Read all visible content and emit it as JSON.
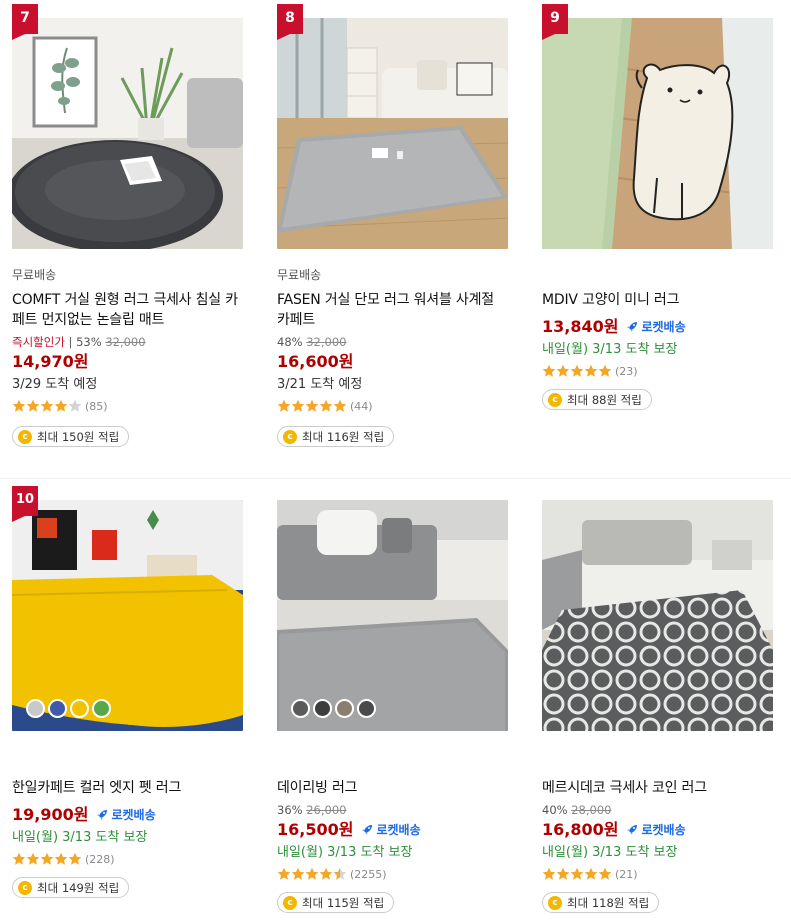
{
  "colors": {
    "rank_red": "#c8102e",
    "price_red": "#ae0000",
    "rocket_blue": "#1d6ae5",
    "delivery_green": "#2f8f3a",
    "star_orange": "#f5a623",
    "coin_yellow": "#f3b700"
  },
  "products": [
    {
      "rank": "7",
      "image": "round-gray-shaggy-rug",
      "shipping": "무료배송",
      "title": "COMFT 거실 원형 러그 극세사 침실 카페트 먼지없는 논슬립 매트",
      "discount": {
        "instant": "즉시할인가",
        "percent": "53%",
        "original": "32,000"
      },
      "price": "14,970원",
      "rocket": "",
      "delivery": "3/29 도착 예정",
      "rating": 4,
      "review_count": "(85)",
      "points": "최대 150원 적립"
    },
    {
      "rank": "8",
      "image": "gray-shortpile-rug-living-room",
      "shipping": "무료배송",
      "title": "FASEN 거실 단모 러그 워셔블 사계절 카페트",
      "discount": {
        "instant": "",
        "percent": "48%",
        "original": "32,000"
      },
      "price": "16,600원",
      "rocket": "",
      "delivery": "3/21 도착 예정",
      "rating": 5,
      "review_count": "(44)",
      "points": "최대 116원 적립"
    },
    {
      "rank": "9",
      "image": "cat-shaped-mini-rug",
      "shipping": "",
      "title": "MDIV 고양이 미니 러그",
      "discount": {
        "instant": "",
        "percent": "",
        "original": ""
      },
      "price": "13,840원",
      "rocket": "로켓배송",
      "delivery": "내일(월) 3/13 도착 보장",
      "rating": 5,
      "review_count": "(23)",
      "points": "최대 88원 적립"
    },
    {
      "rank": "10",
      "image": "yellow-color-edge-pet-rug",
      "shipping": "",
      "title": "한일카페트 컬러 엣지 펫 러그",
      "discount": {
        "instant": "",
        "percent": "",
        "original": ""
      },
      "price": "19,900원",
      "rocket": "로켓배송",
      "delivery": "내일(월) 3/13 도착 보장",
      "rating": 5,
      "review_count": "(228)",
      "points": "최대 149원 적립",
      "swatches": [
        "#c9c9c9",
        "#3e5aa8",
        "#f2c200",
        "#58a84a"
      ]
    },
    {
      "rank": "",
      "image": "daily-gray-rug-sofa",
      "shipping": "",
      "title": "데이리빙 러그",
      "discount": {
        "instant": "",
        "percent": "36%",
        "original": "26,000"
      },
      "price": "16,500원",
      "rocket": "로켓배송",
      "delivery": "내일(월) 3/13 도착 보장",
      "rating": 4.5,
      "review_count": "(2255)",
      "points": "최대 115원 적립",
      "swatches": [
        "#5a5a5a",
        "#3d3d3d",
        "#8a7f6e",
        "#4a4a4a"
      ]
    },
    {
      "rank": "",
      "image": "geometric-coin-pattern-rug",
      "shipping": "",
      "title": "메르시데코 극세사 코인 러그",
      "discount": {
        "instant": "",
        "percent": "40%",
        "original": "28,000"
      },
      "price": "16,800원",
      "rocket": "로켓배송",
      "delivery": "내일(월) 3/13 도착 보장",
      "rating": 5,
      "review_count": "(21)",
      "points": "최대 118원 적립"
    }
  ]
}
